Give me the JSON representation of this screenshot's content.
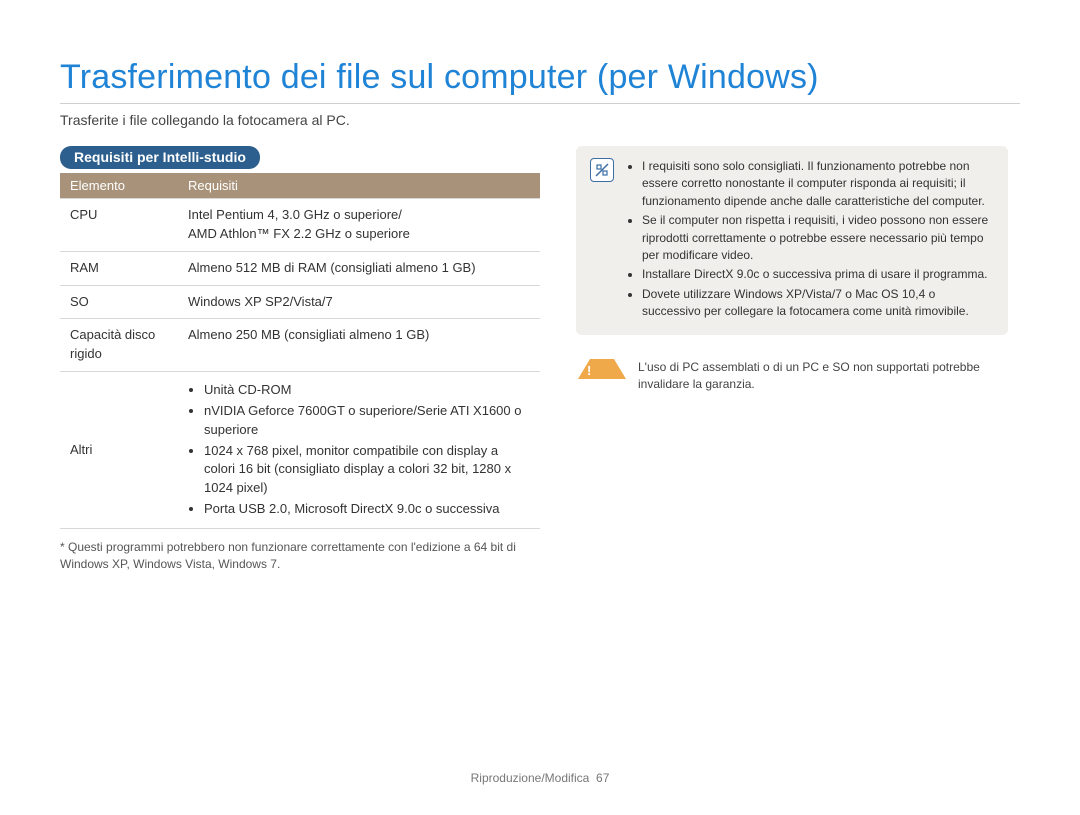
{
  "title": "Trasferimento dei file sul computer (per Windows)",
  "subtitle": "Trasferite i file collegando la fotocamera al PC.",
  "section_heading": "Requisiti per Intelli-studio",
  "table": {
    "headers": {
      "col1": "Elemento",
      "col2": "Requisiti"
    },
    "rows": {
      "cpu": {
        "label": "CPU",
        "value": "Intel Pentium 4, 3.0 GHz o superiore/\nAMD Athlon™ FX 2.2 GHz o superiore"
      },
      "ram": {
        "label": "RAM",
        "value": "Almeno 512 MB di RAM (consigliati almeno 1 GB)"
      },
      "so": {
        "label": "SO",
        "value": "Windows XP SP2/Vista/7"
      },
      "disk": {
        "label": "Capacità disco rigido",
        "value": "Almeno 250 MB (consigliati almeno 1 GB)"
      },
      "other": {
        "label": "Altri",
        "bullets": [
          "Unità CD-ROM",
          "nVIDIA Geforce 7600GT o superiore/Serie ATI X1600 o superiore",
          "1024 x 768 pixel, monitor compatibile con display a colori 16 bit (consigliato display a colori 32 bit, 1280 x 1024 pixel)",
          "Porta USB 2.0, Microsoft DirectX 9.0c o successiva"
        ]
      }
    }
  },
  "footnote": "* Questi programmi potrebbero non funzionare correttamente con l'edizione a 64 bit di Windows XP, Windows Vista, Windows 7.",
  "info_bullets": [
    "I requisiti sono solo consigliati. Il funzionamento potrebbe non essere corretto nonostante il computer risponda ai requisiti; il funzionamento dipende anche dalle caratteristiche del computer.",
    "Se il computer non rispetta i requisiti, i video possono non essere riprodotti correttamente o potrebbe essere necessario più tempo per modificare video.",
    "Installare DirectX 9.0c o successiva prima di usare il programma.",
    "Dovete utilizzare Windows XP/Vista/7 o Mac OS 10,4 o successivo per collegare la fotocamera come unità rimovibile."
  ],
  "warning_text": "L'uso di PC assemblati o di un PC e SO non supportati potrebbe invalidare la garanzia.",
  "footer": {
    "section": "Riproduzione/Modifica",
    "page": "67"
  }
}
